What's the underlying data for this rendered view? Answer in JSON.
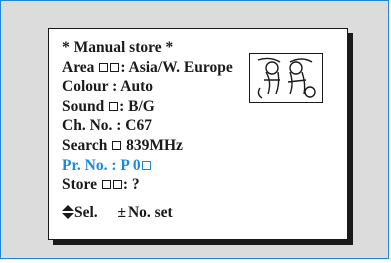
{
  "menu": {
    "title": "* Manual store *",
    "area": {
      "label": "Area",
      "value": ": Asia/W. Europe"
    },
    "colour": {
      "label": "Colour",
      "value": ": Auto"
    },
    "sound": {
      "label": "Sound",
      "value": ": B/G"
    },
    "channel": {
      "label": "Ch. No.",
      "value": ": C67"
    },
    "search": {
      "label": "Search",
      "value": "839MHz"
    },
    "program": {
      "label": "Pr. No.",
      "value": ": P 0"
    },
    "store": {
      "label": "Store",
      "value": ": ?"
    },
    "footer": {
      "select": "Sel.",
      "number": "No. set"
    }
  },
  "colors": {
    "accent": "#1e88d8",
    "text": "#1a1a1a",
    "frame_bg": "#dcdcdc"
  },
  "icons": [
    "updown-arrow-icon",
    "plus-minus-icon",
    "box-icon",
    "logo-illustration"
  ]
}
